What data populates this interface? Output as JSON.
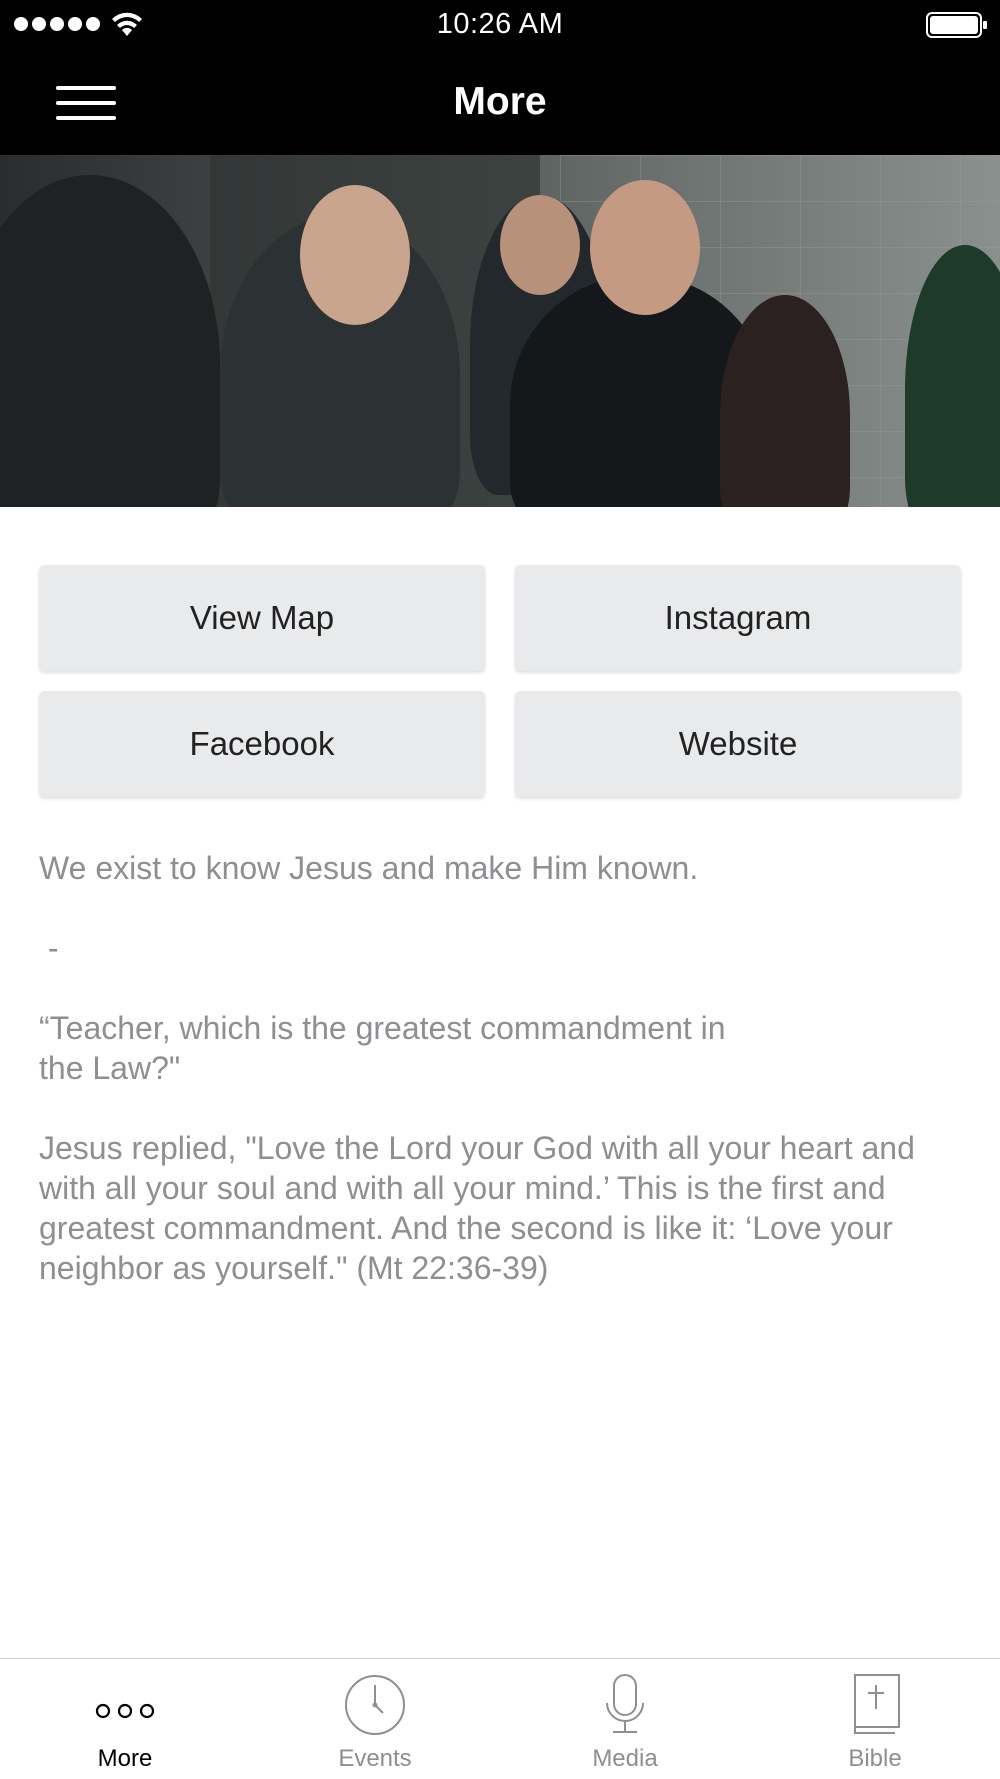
{
  "status_bar": {
    "time": "10:26 AM"
  },
  "nav": {
    "title": "More"
  },
  "actions": [
    {
      "label": "View Map"
    },
    {
      "label": "Instagram"
    },
    {
      "label": "Facebook"
    },
    {
      "label": "Website"
    }
  ],
  "content": {
    "paragraphs": [
      "We exist to know Jesus and make Him known.",
      " -",
      "“Teacher, which is the greatest commandment in\nthe Law?\"",
      "Jesus replied, \"Love the Lord your God with all your heart and with all your soul and with all your mind.’ This is the first and greatest commandment. And the second is like it: ‘Love your neighbor as yourself.\" (Mt 22:36-39)"
    ]
  },
  "tabs": [
    {
      "label": "More",
      "icon": "more-dots-icon",
      "active": true
    },
    {
      "label": "Events",
      "icon": "clock-icon",
      "active": false
    },
    {
      "label": "Media",
      "icon": "microphone-icon",
      "active": false
    },
    {
      "label": "Bible",
      "icon": "bible-icon",
      "active": false
    }
  ],
  "colors": {
    "header_bg": "#000000",
    "button_bg": "#e9eaec",
    "body_text": "#8e8e93",
    "tab_inactive": "#8e8e93"
  }
}
